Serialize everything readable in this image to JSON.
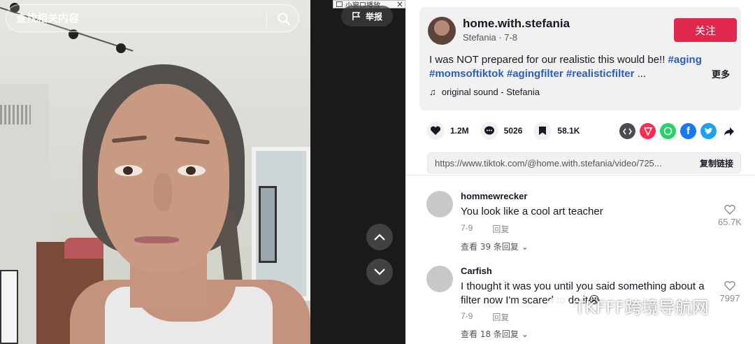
{
  "search": {
    "placeholder": "查找相关内容"
  },
  "mini_window": {
    "label": "小窗口播放",
    "close": "×"
  },
  "report": {
    "label": "举报"
  },
  "post": {
    "username": "home.with.stefania",
    "author": "Stefania",
    "date": "7-8",
    "subline": "Stefania · 7-8",
    "follow_label": "关注",
    "description_text": "I was NOT prepared for our realistic this would be!!",
    "tags": [
      "#aging",
      "#momsoftiktok",
      "#agingfilter",
      "#realisticfilter"
    ],
    "ellipsis": "...",
    "more_label": "更多",
    "sound": "original sound - Stefania"
  },
  "stats": {
    "likes": "1.2M",
    "comments": "5026",
    "saves": "58.1K"
  },
  "share_icons": [
    "embed-icon",
    "send-icon",
    "whatsapp-icon",
    "facebook-icon",
    "twitter-icon",
    "share-arrow-icon"
  ],
  "link": {
    "url": "https://www.tiktok.com/@home.with.stefania/video/725...",
    "copy_label": "复制链接"
  },
  "comments": [
    {
      "user": "hommewrecker",
      "text": "You look like a cool art teacher",
      "date": "7-9",
      "reply_label": "回复",
      "likes": "65.7K",
      "view_replies": "查看 39 条回复"
    },
    {
      "user": "Carfish",
      "text": "I thought it was you until you said something about a filter now I'm scared to do it😭",
      "date": "7-9",
      "reply_label": "回复",
      "likes": "7997",
      "view_replies": "查看 18 条回复"
    }
  ],
  "watermark": "TKFFF跨境导航网",
  "colors": {
    "accent": "#e0284f",
    "tag": "#2b5db9",
    "panel_bg": "#f1f1f2"
  }
}
